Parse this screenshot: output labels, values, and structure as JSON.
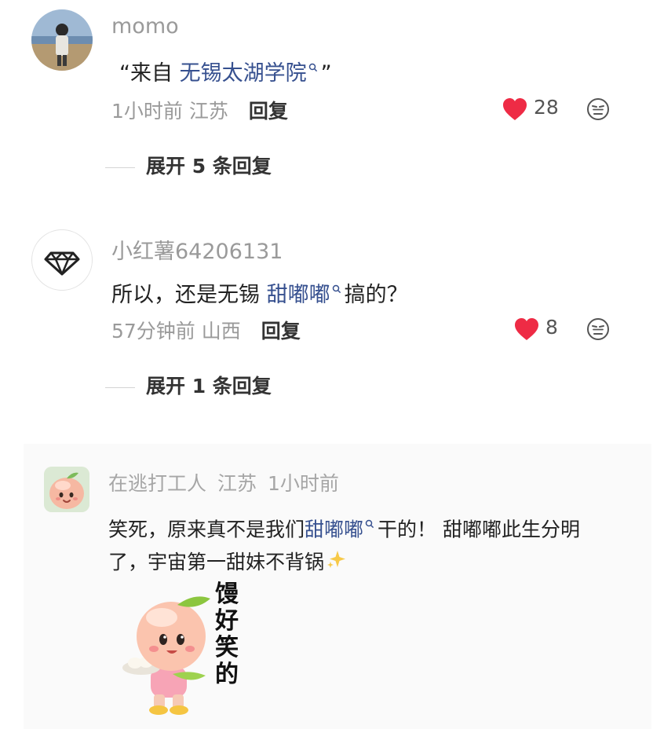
{
  "comments": [
    {
      "username": "momo",
      "content": {
        "prefix": "“来自 ",
        "link": "无锡太湖学院",
        "suffix": "”"
      },
      "time": "1小时前",
      "location": "江苏",
      "reply_label": "回复",
      "likes": "28",
      "expand_label": "展开 5 条回复"
    },
    {
      "username": "小红薯64206131",
      "content": {
        "prefix": "所以，还是无锡 ",
        "link": "甜嘟嘟",
        "suffix": "搞的？"
      },
      "time": "57分钟前",
      "location": "山西",
      "reply_label": "回复",
      "likes": "8",
      "expand_label": "展开 1 条回复"
    }
  ],
  "quoted": {
    "username": "在逃打工人",
    "location": "江苏",
    "time": "1小时前",
    "line1": {
      "prefix": "笑死，原来真不是我们",
      "link": "甜嘟嘟",
      "suffix": "干的！ 甜嘟嘟此生分明"
    },
    "line2": "了，宇宙第一甜妹不背锅",
    "sticker_text": [
      "馒",
      "好",
      "笑",
      "的"
    ]
  },
  "colors": {
    "like_red": "#ee2b45",
    "link_blue": "#36508f",
    "meta_gray": "#9a9a9a"
  },
  "icons": {
    "like": "heart-icon",
    "dislike": "unamused-face-icon",
    "search": "search-icon",
    "sparkle": "sparkles-emoji"
  }
}
